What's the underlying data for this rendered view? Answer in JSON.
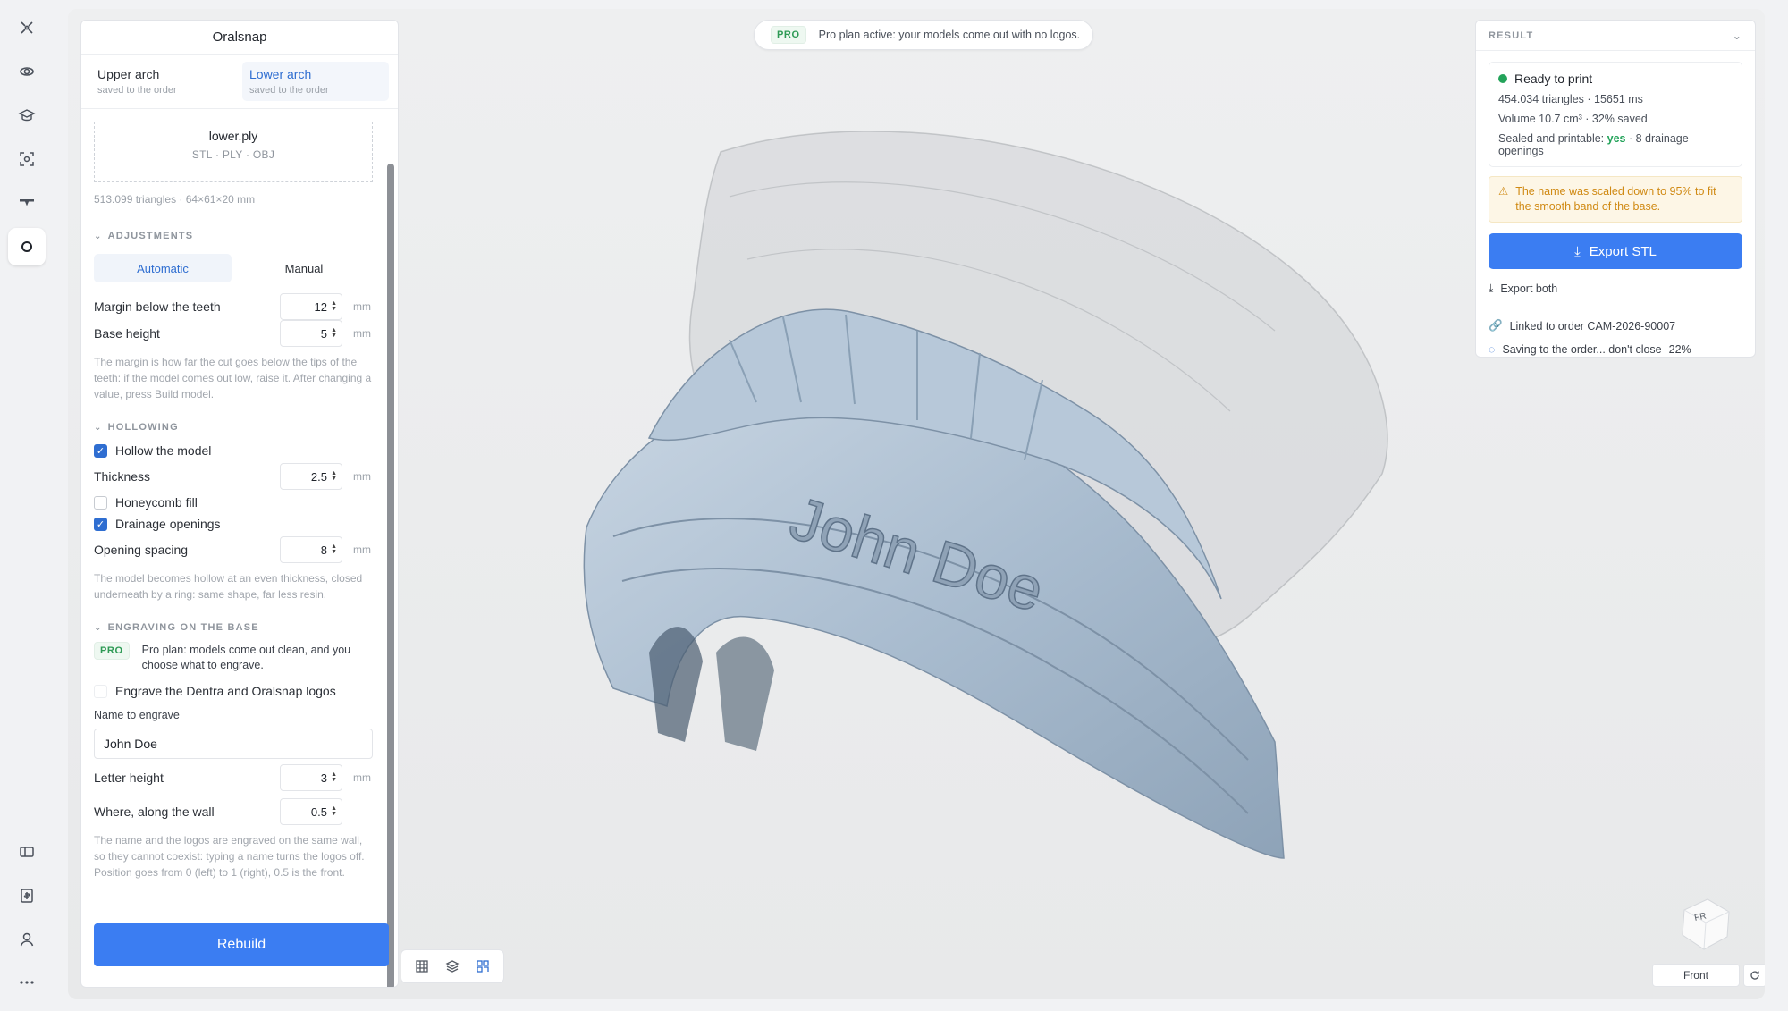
{
  "app": {
    "title": "Oralsnap"
  },
  "banner": {
    "badge": "PRO",
    "text": "Pro plan active: your models come out with no logos."
  },
  "arches": [
    {
      "label": "Upper arch",
      "sub": "saved to the order",
      "active": false
    },
    {
      "label": "Lower arch",
      "sub": "saved to the order",
      "active": true
    }
  ],
  "file": {
    "name": "lower.ply",
    "types": "STL · PLY · OBJ",
    "meta": "513.099 triangles · 64×61×20 mm"
  },
  "adjustments": {
    "heading": "ADJUSTMENTS",
    "modes": [
      "Automatic",
      "Manual"
    ],
    "active_mode": "Automatic",
    "margin": {
      "label": "Margin below the teeth",
      "value": "12",
      "unit": "mm"
    },
    "base": {
      "label": "Base height",
      "value": "5",
      "unit": "mm"
    },
    "help": "The margin is how far the cut goes below the tips of the teeth: if the model comes out low, raise it. After changing a value, press Build model."
  },
  "hollowing": {
    "heading": "HOLLOWING",
    "hollow": {
      "label": "Hollow the model",
      "checked": true
    },
    "thickness": {
      "label": "Thickness",
      "value": "2.5",
      "unit": "mm"
    },
    "honeycomb": {
      "label": "Honeycomb fill",
      "checked": false
    },
    "drainage": {
      "label": "Drainage openings",
      "checked": true
    },
    "spacing": {
      "label": "Opening spacing",
      "value": "8",
      "unit": "mm"
    },
    "help": "The model becomes hollow at an even thickness, closed underneath by a ring: same shape, far less resin."
  },
  "engraving": {
    "heading": "ENGRAVING ON THE BASE",
    "pro_badge": "PRO",
    "pro_text": "Pro plan: models come out clean, and you choose what to engrave.",
    "logos": {
      "label": "Engrave the Dentra and Oralsnap logos",
      "checked": false
    },
    "name_label": "Name to engrave",
    "name_value": "John Doe",
    "letter": {
      "label": "Letter height",
      "value": "3",
      "unit": "mm"
    },
    "position": {
      "label": "Where, along the wall",
      "value": "0.5"
    },
    "help": "The name and the logos are engraved on the same wall, so they cannot coexist: typing a name turns the logos off. Position goes from 0 (left) to 1 (right), 0.5 is the front."
  },
  "rebuild_label": "Rebuild",
  "result": {
    "heading": "RESULT",
    "status": "Ready to print",
    "stats1": "454.034 triangles · 15651 ms",
    "stats2": "Volume 10.7 cm³ · 32% saved",
    "sealed_prefix": "Sealed and printable: ",
    "sealed_value": "yes",
    "sealed_suffix": " · 8 drainage openings",
    "warning": "The name was scaled down to 95% to fit the smooth band of the base.",
    "export_label": "Export STL",
    "export_both": "Export both",
    "linked": "Linked to order CAM-2026-90007",
    "saving": "Saving to the order... don't close",
    "saving_pct": "22%"
  },
  "model": {
    "engraved_text": "John Doe"
  },
  "viewcube": {
    "face": "FR"
  },
  "view_button": "Front",
  "colors": {
    "accent": "#3b7df2",
    "success": "#23a35a",
    "warning": "#d08a14",
    "model": "#a9bccf"
  }
}
